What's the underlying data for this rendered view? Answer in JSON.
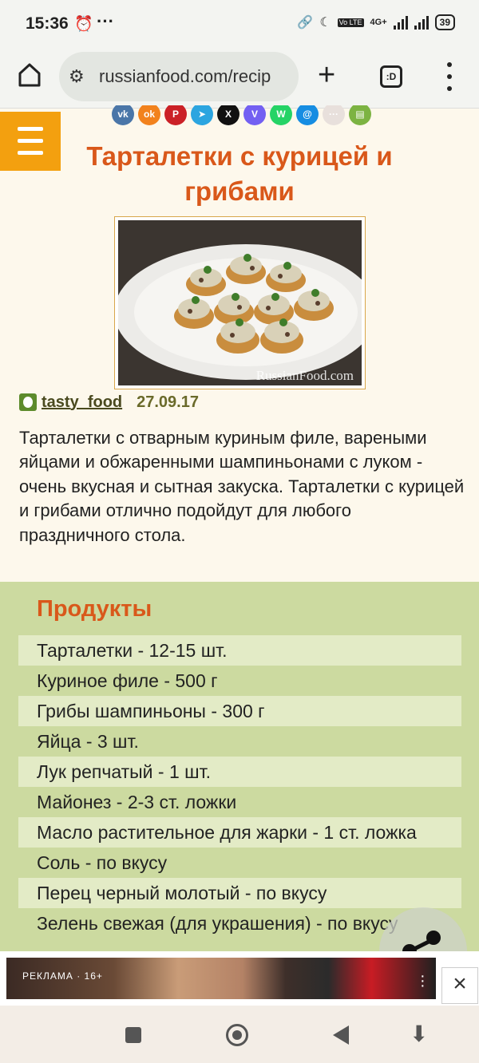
{
  "status_bar": {
    "time": "15:36",
    "more": "···",
    "network": "4G+",
    "volte": "Vo LTE",
    "battery": "39"
  },
  "browser": {
    "url": "russianfood.com/recip",
    "tabs_label": ":D"
  },
  "share_icons": [
    {
      "name": "vk-icon",
      "label": "vk",
      "color": "#4a76a8"
    },
    {
      "name": "odnoklassniki-icon",
      "label": "ok",
      "color": "#f2821d"
    },
    {
      "name": "pinterest-icon",
      "label": "P",
      "color": "#cb2127"
    },
    {
      "name": "telegram-icon",
      "label": "➤",
      "color": "#2ca5e0"
    },
    {
      "name": "x-icon",
      "label": "X",
      "color": "#111111"
    },
    {
      "name": "viber-icon",
      "label": "V",
      "color": "#7360f2"
    },
    {
      "name": "whatsapp-icon",
      "label": "W",
      "color": "#25d366"
    },
    {
      "name": "mailru-icon",
      "label": "@",
      "color": "#168de2"
    },
    {
      "name": "more-share-icon",
      "label": "···",
      "color": "#e8e0dc"
    },
    {
      "name": "print-icon",
      "label": "▤",
      "color": "#7cb342"
    }
  ],
  "recipe": {
    "title": "Тарталетки с курицей и грибами",
    "author": "tasty_food",
    "date": "27.09.17",
    "photo_watermark": "RussianFood.com",
    "description": "Тарталетки с отварным куриным филе, вареными яйцами и обжаренными шампиньонами с луком - очень вкусная и сытная закуска. Тарталетки с курицей и грибами отлично подойдут для любого праздничного стола."
  },
  "products": {
    "heading": "Продукты",
    "items": [
      "Тарталетки - 12-15 шт.",
      "Куриное филе - 500 г",
      "Грибы шампиньоны - 300 г",
      "Яйца - 3 шт.",
      "Лук репчатый - 1 шт.",
      "Майонез - 2-3 ст. ложки",
      "Масло растительное для жарки - 1 ст. ложка",
      "Соль - по вкусу",
      "Перец черный молотый - по вкусу",
      "Зелень свежая (для украшения) - по вкусу"
    ]
  },
  "ad": {
    "badge": "РЕКЛАМА · 16+"
  }
}
